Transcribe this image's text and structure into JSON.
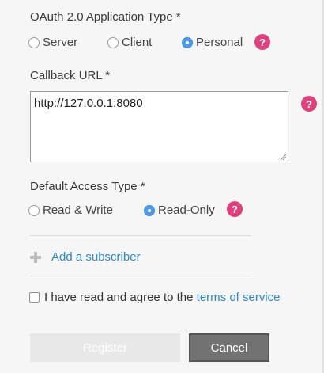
{
  "app_type": {
    "title": "OAuth 2.0 Application Type *",
    "options": [
      {
        "label": "Server",
        "checked": false
      },
      {
        "label": "Client",
        "checked": false
      },
      {
        "label": "Personal",
        "checked": true
      }
    ],
    "help": "?"
  },
  "callback": {
    "title": "Callback URL *",
    "value": "http://127.0.0.1:8080",
    "help": "?"
  },
  "access_type": {
    "title": "Default Access Type *",
    "options": [
      {
        "label": "Read & Write",
        "checked": false
      },
      {
        "label": "Read-Only",
        "checked": true
      }
    ],
    "help": "?"
  },
  "subscriber": {
    "add_label": "Add a subscriber"
  },
  "agreement": {
    "text": "I have read and agree to the ",
    "link": "terms of service",
    "checked": false
  },
  "buttons": {
    "register": "Register",
    "cancel": "Cancel"
  },
  "colors": {
    "help_badge": "#e0407e",
    "link": "#2f88c6",
    "radio_checked": "#4a9be8",
    "cancel_bg": "#727272"
  }
}
